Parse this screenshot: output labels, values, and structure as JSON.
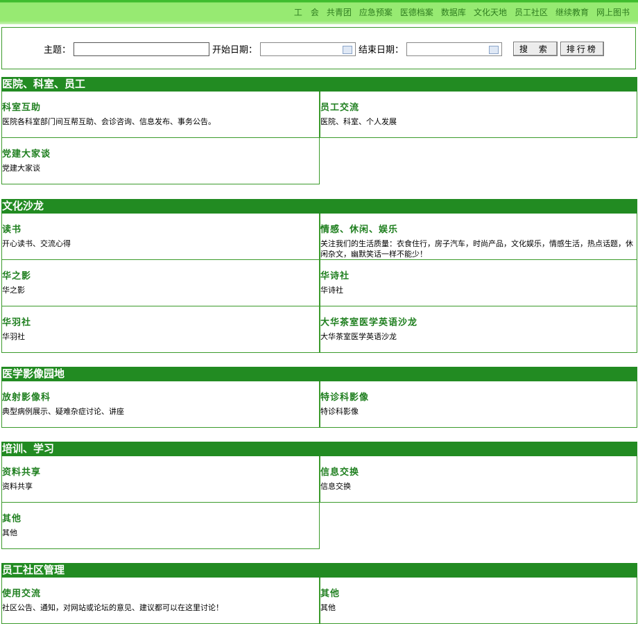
{
  "nav": [
    "工　会",
    "共青团",
    "应急预案",
    "医德档案",
    "数据库",
    "文化天地",
    "员工社区",
    "继续教育",
    "网上图书"
  ],
  "search": {
    "topic_label": "主题：",
    "start_label": "开始日期：",
    "end_label": "结束日期：",
    "search_button": "搜 索",
    "rank_button": "排行榜"
  },
  "sections": [
    {
      "title": "医院、科室、员工",
      "forums": [
        {
          "name": "科室互助",
          "desc": "医院各科室部门间互帮互助、会诊咨询、信息发布、事务公告。"
        },
        {
          "name": "员工交流",
          "desc": "医院、科室、个人发展"
        },
        {
          "name": "党建大家谈",
          "desc": "党建大家谈"
        }
      ]
    },
    {
      "title": "文化沙龙",
      "forums": [
        {
          "name": "读书",
          "desc": "开心读书、交流心得"
        },
        {
          "name": "情感、休闲、娱乐",
          "desc": "关注我们的生活质量：衣食住行，房子汽车，时尚产品，文化娱乐，情感生活，热点话题，休闲杂文，幽默笑话一样不能少！"
        },
        {
          "name": "华之影",
          "desc": "华之影"
        },
        {
          "name": "华诗社",
          "desc": "华诗社"
        },
        {
          "name": "华羽社",
          "desc": "华羽社"
        },
        {
          "name": "大华茶室医学英语沙龙",
          "desc": "大华茶室医学英语沙龙"
        }
      ]
    },
    {
      "title": "医学影像园地",
      "forums": [
        {
          "name": "放射影像科",
          "desc": "典型病例展示、疑难杂症讨论、讲座"
        },
        {
          "name": "特诊科影像",
          "desc": "特诊科影像"
        }
      ]
    },
    {
      "title": "培训、学习",
      "forums": [
        {
          "name": "资料共享",
          "desc": "资料共享"
        },
        {
          "name": "信息交换",
          "desc": "信息交换"
        },
        {
          "name": "其他",
          "desc": "其他"
        }
      ]
    },
    {
      "title": "员工社区管理",
      "forums": [
        {
          "name": "使用交流",
          "desc": "社区公告、通知，对网站或论坛的意见、建议都可以在这里讨论！"
        },
        {
          "name": "其他",
          "desc": "其他"
        }
      ]
    }
  ]
}
